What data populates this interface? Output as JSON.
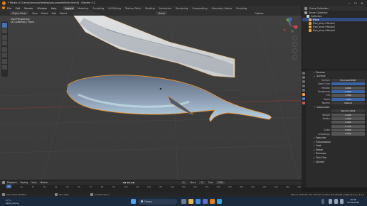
{
  "window": {
    "title": "* Whale [C:\\Users\\Lenovo\\Desktop\\gar-posed\\Whale.blend] - Blender 4.2",
    "minimize": "—",
    "maximize": "☐",
    "close": "✕"
  },
  "menu": {
    "items": [
      "File",
      "Edit",
      "Render",
      "Window",
      "Help"
    ],
    "tabs": [
      "Layout",
      "Modeling",
      "Sculpting",
      "UV Editing",
      "Texture Paint",
      "Shading",
      "Animation",
      "Rendering",
      "Compositing",
      "Geometry Nodes",
      "Scripting"
    ],
    "active_tab": "Layout",
    "scene_label": "Scene",
    "view_layer_label": "ViewLayer"
  },
  "viewport_header": {
    "mode": "Object Mode",
    "items": [
      "View",
      "Select",
      "Add",
      "Object"
    ],
    "transform": "Global",
    "options": "Options"
  },
  "viewport_info": {
    "view": "User Perspective",
    "collection": "(4) Collection | Plane"
  },
  "gizmo": {
    "x": "X",
    "y": "Y",
    "z": "Z"
  },
  "outliner": {
    "header": [
      "Scene Collection"
    ],
    "rows": [
      {
        "label": "Scene Collection",
        "selected": false
      },
      {
        "label": "Collection",
        "selected": false
      },
      {
        "label": "Plane",
        "selected": true
      },
      {
        "label": "Plan_alrey+Whale1",
        "selected": false
      },
      {
        "label": "Plan_alrey+Whale2",
        "selected": false
      },
      {
        "label": "Plan_alrey+Whale3",
        "selected": false
      }
    ]
  },
  "properties": {
    "sections_top": [
      {
        "label": "Preview",
        "open": false
      },
      {
        "label": "Surface",
        "open": true
      }
    ],
    "surface": {
      "label": "Surface",
      "value": "Principled BSDF"
    },
    "fields": [
      {
        "label": "Base Color",
        "value": "",
        "kind": "color"
      },
      {
        "label": "Metallic",
        "value": "0.000",
        "kind": "num"
      },
      {
        "label": "Roughness",
        "value": "0.500",
        "kind": "num"
      },
      {
        "label": "IOR",
        "value": "1.500",
        "kind": "num"
      },
      {
        "label": "Alpha",
        "value": "1.000",
        "kind": "num"
      },
      {
        "label": "Normal",
        "value": "Default",
        "kind": "dark"
      }
    ],
    "subsurface_header": "Subsurface",
    "subsurface_fields": [
      {
        "label": "",
        "value": "Random Walk",
        "kind": "dark"
      },
      {
        "label": "Weight",
        "value": "0.000",
        "kind": "num"
      },
      {
        "label": "Radius",
        "value": "1.000",
        "kind": "num"
      },
      {
        "label": "",
        "value": "0.200",
        "kind": "num"
      },
      {
        "label": "",
        "value": "0.100",
        "kind": "num"
      },
      {
        "label": "Scale",
        "value": "0.050",
        "kind": "num"
      },
      {
        "label": "Anisotropy",
        "value": "0.000",
        "kind": "num"
      }
    ],
    "sections_bottom": [
      "Specular",
      "Transmission",
      "Coat",
      "Sheen",
      "Emission",
      "Thin Film"
    ],
    "footer": "Volume"
  },
  "timeline": {
    "items": [
      "Playback",
      "Keying",
      "View",
      "Marker"
    ],
    "current_frame": "1",
    "ticks": [
      "0",
      "10",
      "20",
      "30",
      "40",
      "50",
      "60",
      "70",
      "80",
      "90",
      "100",
      "110",
      "120",
      "130",
      "140",
      "150",
      "160",
      "170",
      "180",
      "190",
      "200",
      "210",
      "220",
      "230",
      "240",
      "250"
    ],
    "start_label": "Start",
    "start": "1",
    "end_label": "End",
    "end": "250"
  },
  "statusbar": {
    "left": "Set Active Modifier",
    "mid1": "Pan View",
    "mid2": "Context Menu",
    "right": "Plane | Verts:14,312 | Faces:14,192 | Tris:28,384 | Objects:1/4 | 4.2.0"
  },
  "taskbar": {
    "weather_temp": "17°C",
    "weather_desc": "Partly sunny",
    "search_placeholder": "Поиск",
    "time": "15:09",
    "date": "18.09.2024"
  },
  "colors": {
    "selection": "#4772b3",
    "whale_outline": "#e8902a",
    "viewport_bg": "#3d3d3d"
  }
}
